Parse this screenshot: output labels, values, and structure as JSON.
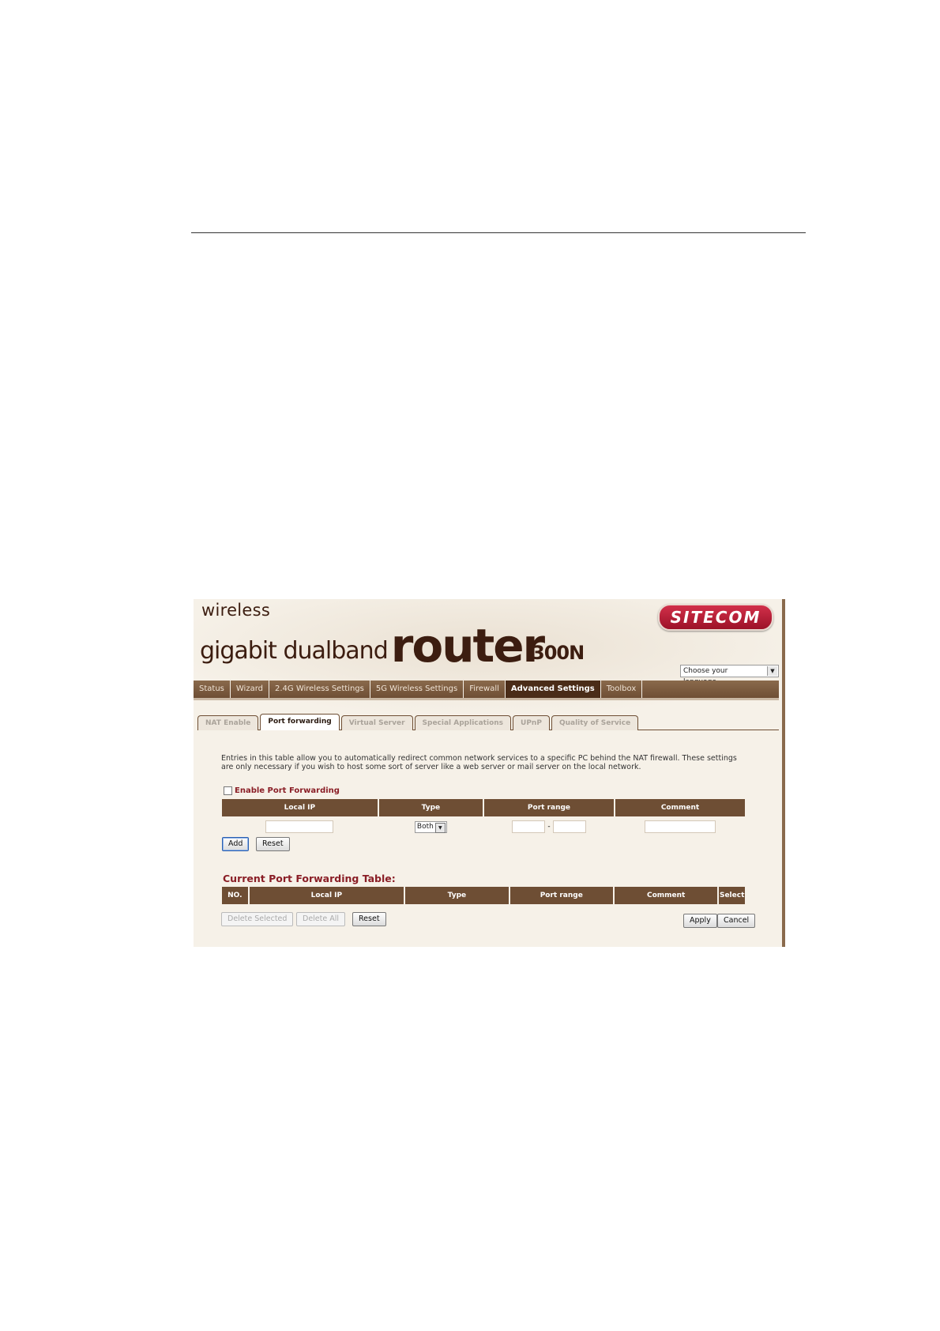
{
  "header": {
    "line1": "wireless",
    "line2": "gigabit dualband",
    "line2_big": "router",
    "model": "300N",
    "logo": "SITECOM",
    "language_label": "Choose your language"
  },
  "nav": {
    "items": [
      "Status",
      "Wizard",
      "2.4G Wireless Settings",
      "5G Wireless Settings",
      "Firewall",
      "Advanced Settings",
      "Toolbox"
    ],
    "active": "Advanced Settings"
  },
  "subtabs": {
    "items": [
      "NAT Enable",
      "Port forwarding",
      "Virtual Server",
      "Special Applications",
      "UPnP",
      "Quality of Service"
    ],
    "active": "Port forwarding"
  },
  "content": {
    "description": "Entries in this table allow you to automatically redirect common network services to a specific PC behind the NAT firewall. These settings are only necessary if you wish to host some sort of server like a web server or mail server on the local network.",
    "enable_label": "Enable Port Forwarding",
    "enable_checked": false
  },
  "entry_table": {
    "headers": [
      "Local IP",
      "Type",
      "Port range",
      "Comment"
    ],
    "local_ip": "",
    "type_value": "Both",
    "port_from": "",
    "port_to": "",
    "range_separator": "-",
    "comment": ""
  },
  "entry_buttons": {
    "add": "Add",
    "reset": "Reset"
  },
  "current_table": {
    "title": "Current Port Forwarding Table:",
    "headers": [
      "NO.",
      "Local IP",
      "Type",
      "Port range",
      "Comment",
      "Select"
    ]
  },
  "bottom_buttons": {
    "delete_selected": "Delete Selected",
    "delete_all": "Delete All",
    "reset": "Reset",
    "apply": "Apply",
    "cancel": "Cancel"
  },
  "colors": {
    "brand_brown": "#6e4e34",
    "accent_red": "#8a1e26",
    "logo_red": "#c0233c",
    "page_bg": "#f6f1e8"
  }
}
